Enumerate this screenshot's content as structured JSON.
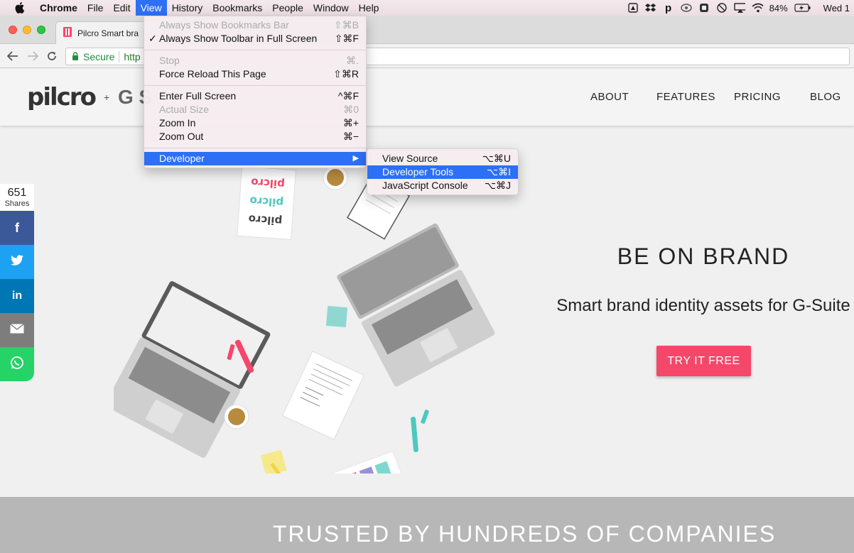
{
  "menubar": {
    "app": "Chrome",
    "items": [
      "File",
      "Edit",
      "View",
      "History",
      "Bookmarks",
      "People",
      "Window",
      "Help"
    ],
    "active": "View",
    "battery": "84%",
    "clock": "Wed 1"
  },
  "tab": {
    "title": "Pilcro Smart bra"
  },
  "omnibox": {
    "secure_label": "Secure",
    "url": "http"
  },
  "site": {
    "logo_text": "pilcro",
    "logo_plus": "+",
    "logo_partner": "G S",
    "nav": [
      "ABOUT",
      "FEATURES",
      "PRICING",
      "BLOG"
    ]
  },
  "hero": {
    "title": "BE ON BRAND",
    "subtitle": "Smart brand identity assets for G-Suite",
    "cta": "TRY IT FREE",
    "sticker_logo": "pilcro"
  },
  "share": {
    "count": "651",
    "label": "Shares",
    "networks": [
      "facebook",
      "twitter",
      "linkedin",
      "email",
      "whatsapp"
    ],
    "colors": {
      "facebook": "#3b5998",
      "twitter": "#1da1f2",
      "linkedin": "#0077b5",
      "email": "#7d7d7d",
      "whatsapp": "#25d366"
    }
  },
  "trusted": {
    "heading": "TRUSTED BY HUNDREDS OF COMPANIES"
  },
  "view_menu": {
    "items": [
      {
        "label": "Always Show Bookmarks Bar",
        "shortcut": "⇧⌘B",
        "disabled": true
      },
      {
        "label": "Always Show Toolbar in Full Screen",
        "shortcut": "⇧⌘F",
        "checked": true
      },
      {
        "label": "Stop",
        "shortcut": "⌘.",
        "disabled": true
      },
      {
        "label": "Force Reload This Page",
        "shortcut": "⇧⌘R"
      },
      {
        "label": "Enter Full Screen",
        "shortcut": "^⌘F"
      },
      {
        "label": "Actual Size",
        "shortcut": "⌘0",
        "disabled": true
      },
      {
        "label": "Zoom In",
        "shortcut": "⌘+"
      },
      {
        "label": "Zoom Out",
        "shortcut": "⌘−"
      },
      {
        "label": "Developer",
        "shortcut": "▶",
        "highlighted": true
      }
    ]
  },
  "developer_menu": {
    "items": [
      {
        "label": "View Source",
        "shortcut": "⌥⌘U"
      },
      {
        "label": "Developer Tools",
        "shortcut": "⌥⌘I",
        "highlighted": true
      },
      {
        "label": "JavaScript Console",
        "shortcut": "⌥⌘J"
      }
    ]
  }
}
